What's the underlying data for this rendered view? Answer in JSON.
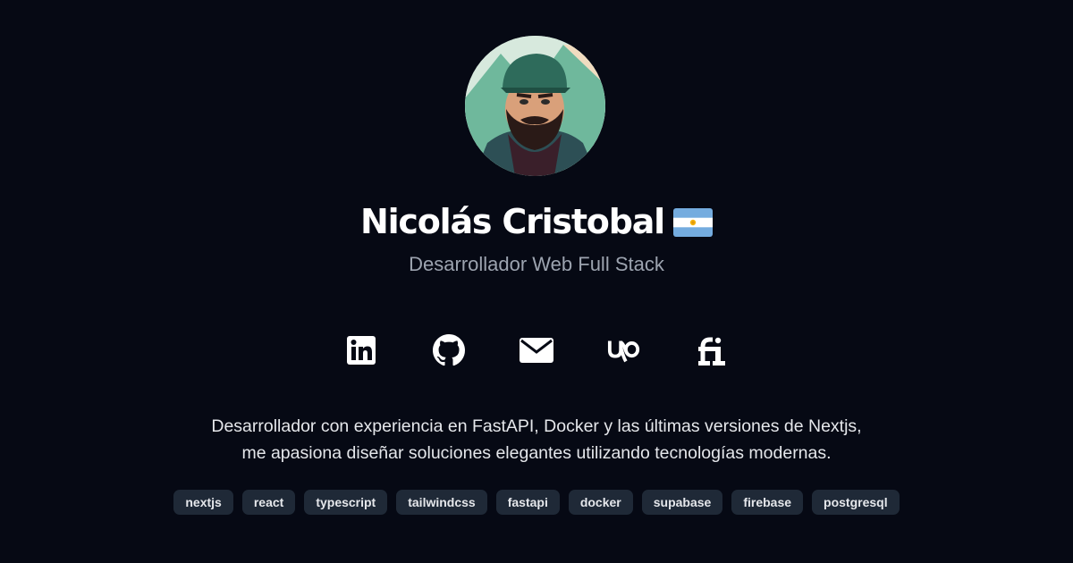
{
  "profile": {
    "name": "Nicolás Cristobal",
    "flag_icon": "argentina-flag-icon",
    "role": "Desarrollador Web Full Stack"
  },
  "socials": [
    {
      "icon": "linkedin-icon"
    },
    {
      "icon": "github-icon"
    },
    {
      "icon": "mail-icon"
    },
    {
      "icon": "upwork-icon"
    },
    {
      "icon": "fiverr-icon"
    }
  ],
  "bio": {
    "line1": "Desarrollador con experiencia en FastAPI, Docker y las últimas versiones de Nextjs,",
    "line2": "me apasiona diseñar soluciones elegantes utilizando tecnologías modernas."
  },
  "tags": [
    "nextjs",
    "react",
    "typescript",
    "tailwindcss",
    "fastapi",
    "docker",
    "supabase",
    "firebase",
    "postgresql"
  ],
  "colors": {
    "background": "#060914",
    "text": "#ffffff",
    "muted": "#9ca3af",
    "tag_bg": "#1f2937"
  }
}
